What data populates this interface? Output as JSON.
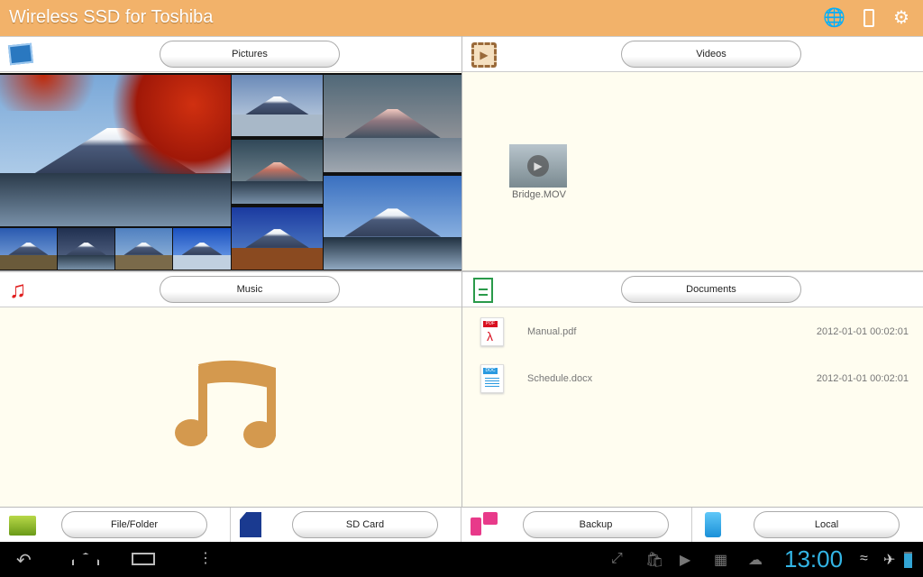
{
  "app": {
    "title": "Wireless SSD for Toshiba",
    "header_icons": [
      "network-icon",
      "battery-icon",
      "settings-icon"
    ]
  },
  "pictures": {
    "label": "Pictures"
  },
  "videos": {
    "label": "Videos",
    "items": [
      {
        "name": "Bridge.MOV"
      }
    ]
  },
  "music": {
    "label": "Music"
  },
  "documents": {
    "label": "Documents",
    "items": [
      {
        "name": "Manual.pdf",
        "date": "2012-01-01 00:02:01",
        "type": "PDF"
      },
      {
        "name": "Schedule.docx",
        "date": "2012-01-01 00:02:01",
        "type": "DOC"
      }
    ]
  },
  "toolbar": {
    "file_folder": "File/Folder",
    "sd_card": "SD Card",
    "backup": "Backup",
    "local": "Local"
  },
  "statusbar": {
    "time": "13:00"
  },
  "colors": {
    "header": "#f2b26a",
    "accent_brown": "#d4994e",
    "clock": "#33b5e5"
  }
}
